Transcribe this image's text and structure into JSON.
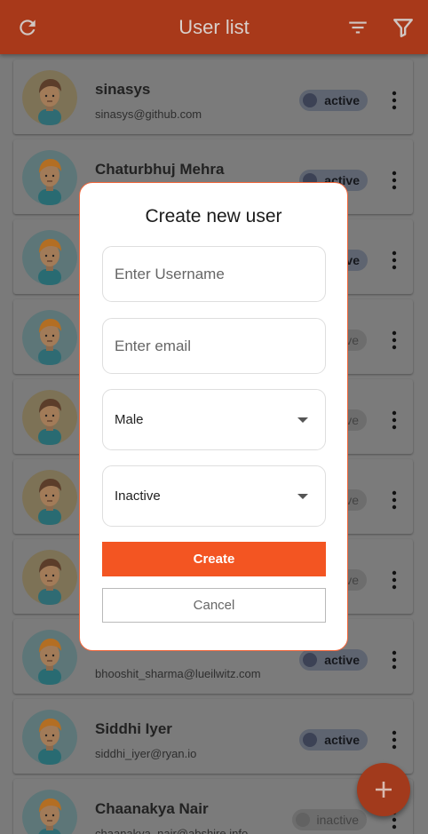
{
  "appbar": {
    "title": "User list",
    "icons": [
      "refresh-icon",
      "sort-icon",
      "filter-icon"
    ],
    "color": "#a8391a"
  },
  "users": [
    {
      "name": "sinasys",
      "email": "sinasys@github.com",
      "status": "active"
    },
    {
      "name": "Chaturbhuj Mehra",
      "email": "",
      "status": "active"
    },
    {
      "name": "",
      "email": "",
      "status": "active"
    },
    {
      "name": "",
      "email": "",
      "status": "inactive"
    },
    {
      "name": "",
      "email": "",
      "status": "inactive"
    },
    {
      "name": "",
      "email": "",
      "status": "inactive"
    },
    {
      "name": "",
      "email": "",
      "status": "inactive"
    },
    {
      "name": "",
      "email": "bhooshit_sharma@lueilwitz.com",
      "status": "active"
    },
    {
      "name": "Siddhi Iyer",
      "email": "siddhi_iyer@ryan.io",
      "status": "active"
    },
    {
      "name": "Chaanakya Nair",
      "email": "chaanakya_nair@abshire.info",
      "status": "inactive"
    }
  ],
  "dialog": {
    "title": "Create new user",
    "username_placeholder": "Enter Username",
    "email_placeholder": "Enter email",
    "gender_value": "Male",
    "status_value": "Inactive",
    "create_label": "Create",
    "cancel_label": "Cancel",
    "accent_color": "#f35522"
  },
  "fab": {
    "icon": "add-icon"
  }
}
